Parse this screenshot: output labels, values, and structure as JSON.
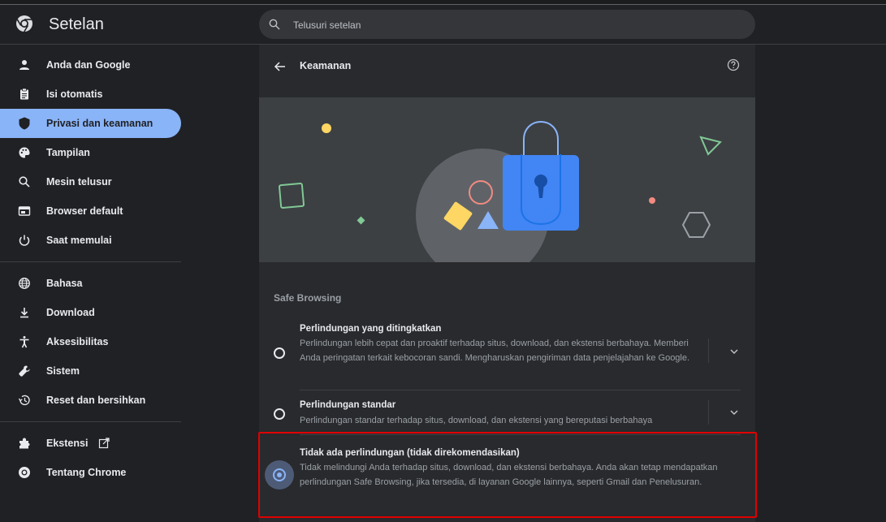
{
  "header": {
    "app_title": "Setelan",
    "search_placeholder": "Telusuri setelan"
  },
  "sidebar": {
    "items": [
      {
        "label": "Anda dan Google",
        "icon": "person-icon"
      },
      {
        "label": "Isi otomatis",
        "icon": "clipboard-icon"
      },
      {
        "label": "Privasi dan keamanan",
        "icon": "shield-icon",
        "active": true
      },
      {
        "label": "Tampilan",
        "icon": "palette-icon"
      },
      {
        "label": "Mesin telusur",
        "icon": "search-icon"
      },
      {
        "label": "Browser default",
        "icon": "browser-icon"
      },
      {
        "label": "Saat memulai",
        "icon": "power-icon"
      },
      {
        "label": "Bahasa",
        "icon": "globe-icon"
      },
      {
        "label": "Download",
        "icon": "download-icon"
      },
      {
        "label": "Aksesibilitas",
        "icon": "accessibility-icon"
      },
      {
        "label": "Sistem",
        "icon": "wrench-icon"
      },
      {
        "label": "Reset dan bersihkan",
        "icon": "restore-icon"
      },
      {
        "label": "Ekstensi",
        "icon": "puzzle-icon"
      },
      {
        "label": "Tentang Chrome",
        "icon": "chrome-icon"
      }
    ]
  },
  "main": {
    "page_title": "Keamanan",
    "section_title": "Safe Browsing",
    "options": [
      {
        "title": "Perlindungan yang ditingkatkan",
        "desc": "Perlindungan lebih cepat dan proaktif terhadap situs, download, dan ekstensi berbahaya. Memberi Anda peringatan terkait kebocoran sandi. Mengharuskan pengiriman data penjelajahan ke Google.",
        "selected": false
      },
      {
        "title": "Perlindungan standar",
        "desc": "Perlindungan standar terhadap situs, download, dan ekstensi yang bereputasi berbahaya",
        "selected": false
      },
      {
        "title": "Tidak ada perlindungan (tidak direkomendasikan)",
        "desc": "Tidak melindungi Anda terhadap situs, download, dan ekstensi berbahaya. Anda akan tetap mendapatkan perlindungan Safe Browsing, jika tersedia, di layanan Google lainnya, seperti Gmail dan Penelusuran.",
        "selected": true
      }
    ]
  },
  "colors": {
    "accent": "#8ab4f8",
    "background": "#202124",
    "card": "#292a2d",
    "highlight_border": "#e00000"
  }
}
